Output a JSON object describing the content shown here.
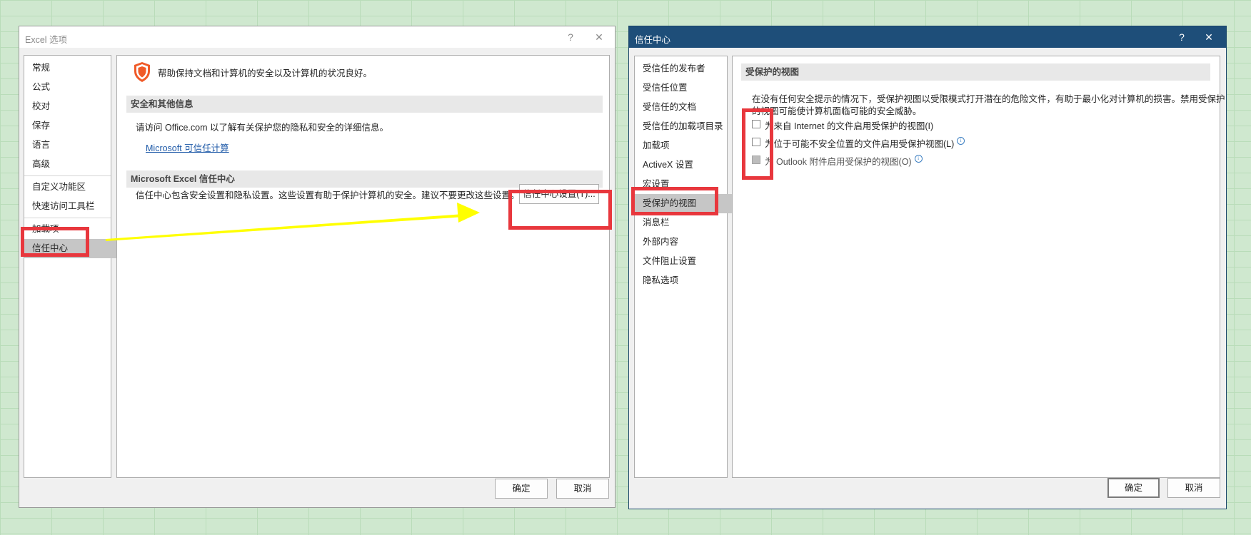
{
  "excel_options": {
    "title": "Excel 选项",
    "help": "?",
    "close": "✕",
    "nav_items": [
      "常规",
      "公式",
      "校对",
      "保存",
      "语言",
      "高级",
      "自定义功能区",
      "快速访问工具栏",
      "加载项",
      "信任中心"
    ],
    "header_text": "帮助保持文档和计算机的安全以及计算机的状况良好。",
    "section1_title": "安全和其他信息",
    "section1_text": "请访问 Office.com 以了解有关保护您的隐私和安全的详细信息。",
    "section1_link": "Microsoft 可信任计算",
    "section2_title": "Microsoft Excel 信任中心",
    "section2_text": "信任中心包含安全设置和隐私设置。这些设置有助于保护计算机的安全。建议不要更改这些设置。",
    "trust_button": "信任中心设置(T)...",
    "ok": "确定",
    "cancel": "取消"
  },
  "trust_center": {
    "title": "信任中心",
    "help": "?",
    "close": "✕",
    "nav_items": [
      "受信任的发布者",
      "受信任位置",
      "受信任的文档",
      "受信任的加载项目录",
      "加载项",
      "ActiveX 设置",
      "宏设置",
      "受保护的视图",
      "消息栏",
      "外部内容",
      "文件阻止设置",
      "隐私选项"
    ],
    "section_title": "受保护的视图",
    "description_line1": "在没有任何安全提示的情况下，受保护视图以受限模式打开潜在的危险文件，有助于最小化对计算机的损害。禁用受保护",
    "description_line2": "的视图可能使计算机面临可能的安全威胁。",
    "options": [
      {
        "label": "为来自 Internet 的文件启用受保护的视图(I)",
        "checked": false,
        "disabled": false,
        "info": false
      },
      {
        "label": "为位于可能不安全位置的文件启用受保护视图(L)",
        "checked": false,
        "disabled": false,
        "info": true
      },
      {
        "label": "为 Outlook 附件启用受保护的视图(O)",
        "checked": false,
        "disabled": true,
        "info": true
      }
    ],
    "info_glyph": "i",
    "ok": "确定",
    "cancel": "取消"
  },
  "colors": {
    "highlight_red": "#e8373d",
    "arrow_yellow": "#ffff00",
    "trust_titlebar": "#1e4e79",
    "shield": "#f05a28"
  }
}
